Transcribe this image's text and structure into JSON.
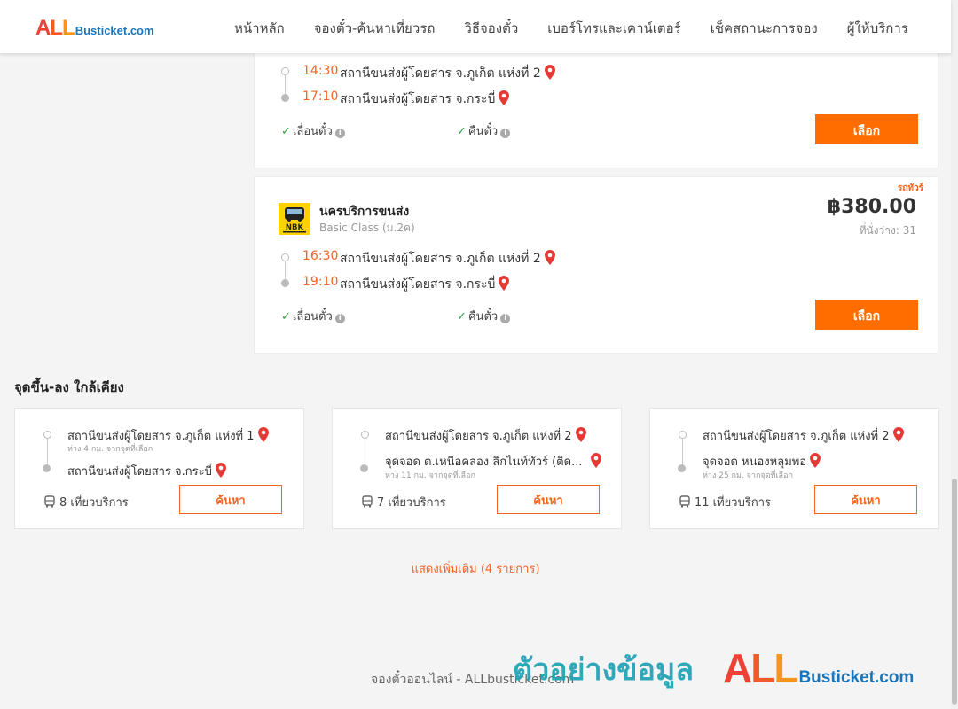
{
  "header": {
    "logo": {
      "letters": [
        "A",
        "L",
        "L"
      ],
      "site": "Busticket.com"
    },
    "nav": [
      "หน้าหลัก",
      "จองตั๋ว-ค้นหาเที่ยวรถ",
      "วิธีจองตั๋ว",
      "เบอร์โทรและเคาน์เตอร์",
      "เช็คสถานะการจอง",
      "ผู้ให้บริการ"
    ]
  },
  "trips": [
    {
      "depart_time": "14:30",
      "depart_station": "สถานีขนส่งผู้โดยสาร จ.ภูเก็ต แห่งที่ 2",
      "arrive_time": "17:10",
      "arrive_station": "สถานีขนส่งผู้โดยสาร จ.กระบี่",
      "feature_1": "เลื่อนตั๋ว",
      "feature_2": "คืนตั๋ว",
      "select_label": "เลือก"
    },
    {
      "tag": "รถทัวร์",
      "operator_name": "นครบริการขนส่ง",
      "operator_class": "Basic Class (ม.2ค)",
      "operator_logo_text": "NBK",
      "price": "฿380.00",
      "seats": "ที่นั่งว่าง: 31",
      "depart_time": "16:30",
      "depart_station": "สถานีขนส่งผู้โดยสาร จ.ภูเก็ต แห่งที่ 2",
      "arrive_time": "19:10",
      "arrive_station": "สถานีขนส่งผู้โดยสาร จ.กระบี่",
      "feature_1": "เลื่อนตั๋ว",
      "feature_2": "คืนตั๋ว",
      "select_label": "เลือก"
    }
  ],
  "nearby": {
    "title": "จุดขึ้น-ลง ใกล้เคียง",
    "cards": [
      {
        "from": "สถานีขนส่งผู้โดยสาร จ.ภูเก็ต แห่งที่ 1",
        "from_distance": "ห่าง 4 กม. จากจุดที่เลือก",
        "to": "สถานีขนส่งผู้โดยสาร จ.กระบี่",
        "to_distance": "",
        "trips": "8 เที่ยวบริการ",
        "search_label": "ค้นหา"
      },
      {
        "from": "สถานีขนส่งผู้โดยสาร จ.ภูเก็ต แห่งที่ 2",
        "from_distance": "",
        "to": "จุดจอด ต.เหนือคลอง ลิกไนท์ทัวร์ (ติด...",
        "to_distance": "ห่าง 11 กม. จากจุดที่เลือก",
        "trips": "7 เที่ยวบริการ",
        "search_label": "ค้นหา"
      },
      {
        "from": "สถานีขนส่งผู้โดยสาร จ.ภูเก็ต แห่งที่ 2",
        "from_distance": "",
        "to": "จุดจอด หนองหลุมพอ",
        "to_distance": "ห่าง 25 กม. จากจุดที่เลือก",
        "trips": "11 เที่ยวบริการ",
        "search_label": "ค้นหา"
      }
    ],
    "show_more": "แสดงเพิ่มเติม (4 รายการ)"
  },
  "footer": {
    "text": "จองตั๋วออนไลน์ - ALLbusticket.com",
    "watermark_text": "ตัวอย่างข้อมูล",
    "watermark_logo_letters": [
      "A",
      "L",
      "L"
    ],
    "watermark_logo_site": "Busticket.com"
  },
  "colors": {
    "accent": "#ff6c00",
    "time": "#f26522",
    "check": "#2e9e3e",
    "pin": "#e53935",
    "watermark": "#1fa3b5"
  }
}
